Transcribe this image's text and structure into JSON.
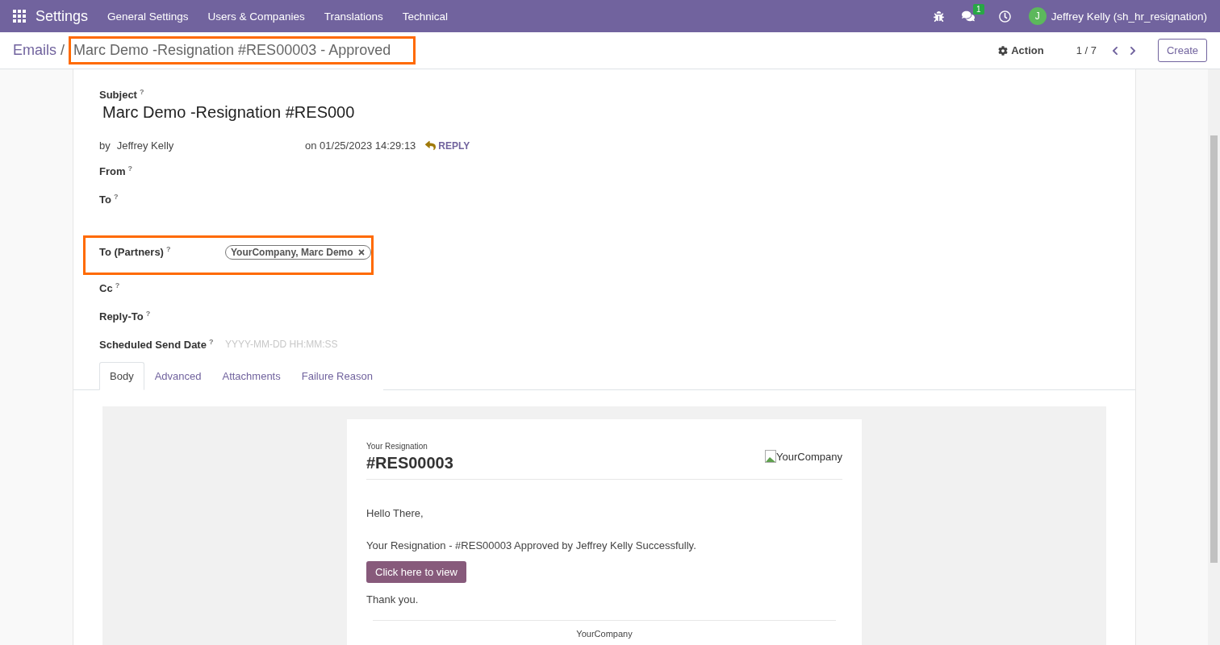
{
  "navbar": {
    "app": "Settings",
    "menus": [
      "General Settings",
      "Users & Companies",
      "Translations",
      "Technical"
    ],
    "messages_badge": "1",
    "user": {
      "initial": "J",
      "name": "Jeffrey Kelly (sh_hr_resignation)"
    }
  },
  "breadcrumb": {
    "parent": "Emails",
    "separator": "/",
    "current": "Marc Demo -Resignation #RES00003 - Approved",
    "highlighted": true
  },
  "control": {
    "action": "Action",
    "pager": "1 / 7",
    "create": "Create"
  },
  "subject": {
    "label": "Subject",
    "help": "?",
    "value": "Marc Demo -Resignation #RES000"
  },
  "meta": {
    "by": "by",
    "author": "Jeffrey Kelly",
    "date": "on 01/25/2023 14:29:13",
    "reply": "REPLY"
  },
  "fields": [
    {
      "label": "From",
      "help": "?",
      "kind": "empty",
      "highlighted": false
    },
    {
      "label": "To",
      "help": "?",
      "kind": "multiline",
      "highlighted": false
    },
    {
      "label": "To (Partners)",
      "help": "?",
      "kind": "tags",
      "tags": [
        "YourCompany, Marc Demo"
      ],
      "highlighted": true
    },
    {
      "label": "Cc",
      "help": "?",
      "kind": "empty",
      "highlighted": false
    },
    {
      "label": "Reply-To",
      "help": "?",
      "kind": "empty",
      "highlighted": false
    },
    {
      "label": "Scheduled Send Date",
      "help": "?",
      "kind": "input",
      "placeholder": "YYYY-MM-DD HH:MM:SS",
      "highlighted": false
    }
  ],
  "tabs": [
    {
      "label": "Body",
      "selected": true
    },
    {
      "label": "Advanced",
      "selected": false
    },
    {
      "label": "Attachments",
      "selected": false
    },
    {
      "label": "Failure Reason",
      "selected": false
    }
  ],
  "email": {
    "kicker": "Your Resignation",
    "reference": "#RES00003",
    "logo_alt": "YourCompany",
    "greeting": "Hello There,",
    "message": "Your Resignation - #RES00003 Approved by Jeffrey Kelly Successfully.",
    "button": "Click here to view",
    "closing": "Thank you.",
    "footer": "YourCompany"
  }
}
